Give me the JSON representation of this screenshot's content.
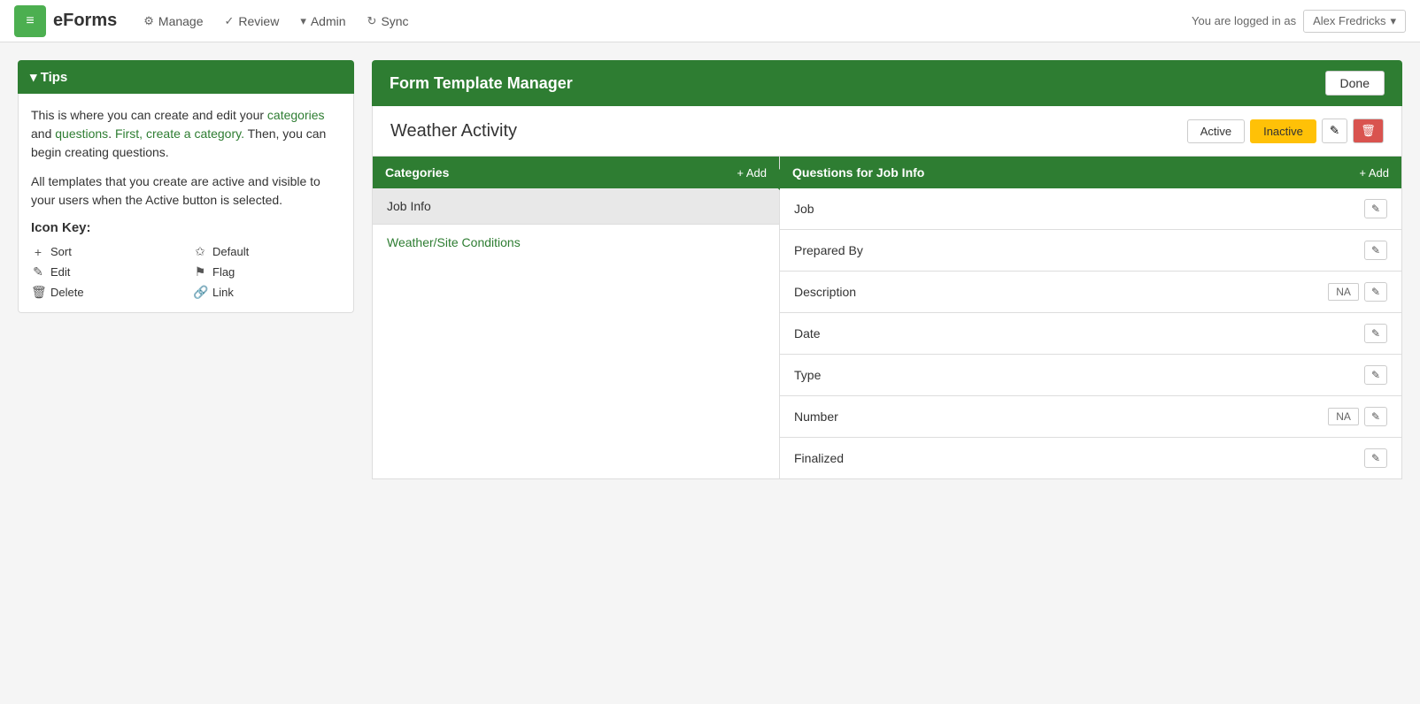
{
  "app": {
    "logo_text": "eForms",
    "logo_icon": "≡"
  },
  "nav": {
    "items": [
      {
        "id": "manage",
        "icon": "⚙",
        "label": "Manage"
      },
      {
        "id": "review",
        "icon": "✓",
        "label": "Review"
      },
      {
        "id": "admin",
        "icon": "▾",
        "label": "Admin"
      },
      {
        "id": "sync",
        "icon": "↻",
        "label": "Sync"
      }
    ],
    "logged_in_label": "You are logged in as",
    "user_name": "Alex Fredricks",
    "user_dropdown_arrow": "▾"
  },
  "tips": {
    "header": "▾  Tips",
    "paragraph1": "This is where you can create and edit your categories and questions. First, create a category. Then, you can begin creating questions.",
    "paragraph2": "All templates that you create are active and visible to your users when the Active button is selected.",
    "icon_key_title": "Icon Key:",
    "icons": [
      {
        "symbol": "+",
        "label": "Sort"
      },
      {
        "symbol": "✩",
        "label": "Default"
      },
      {
        "symbol": "✎",
        "label": "Edit"
      },
      {
        "symbol": "⚑",
        "label": "Flag"
      },
      {
        "symbol": "🗑",
        "label": "Delete"
      },
      {
        "symbol": "🔗",
        "label": "Link"
      }
    ]
  },
  "form_template": {
    "header_title": "Form Template Manager",
    "done_label": "Done",
    "form_name": "Weather Activity",
    "status_active_label": "Active",
    "status_inactive_label": "Inactive",
    "edit_icon": "✎",
    "delete_icon": "🗑"
  },
  "categories": {
    "header": "Categories",
    "add_label": "+ Add",
    "items": [
      {
        "id": "job-info",
        "label": "Job Info",
        "selected": true,
        "is_link": false
      },
      {
        "id": "weather-site",
        "label": "Weather/Site Conditions",
        "selected": false,
        "is_link": true
      }
    ]
  },
  "questions": {
    "header": "Questions for Job Info",
    "add_label": "+ Add",
    "items": [
      {
        "id": "job",
        "label": "Job",
        "has_na": false
      },
      {
        "id": "prepared-by",
        "label": "Prepared By",
        "has_na": false
      },
      {
        "id": "description",
        "label": "Description",
        "has_na": true
      },
      {
        "id": "date",
        "label": "Date",
        "has_na": false
      },
      {
        "id": "type",
        "label": "Type",
        "has_na": false
      },
      {
        "id": "number",
        "label": "Number",
        "has_na": true
      },
      {
        "id": "finalized",
        "label": "Finalized",
        "has_na": false
      }
    ],
    "na_label": "NA",
    "edit_icon": "✎"
  }
}
